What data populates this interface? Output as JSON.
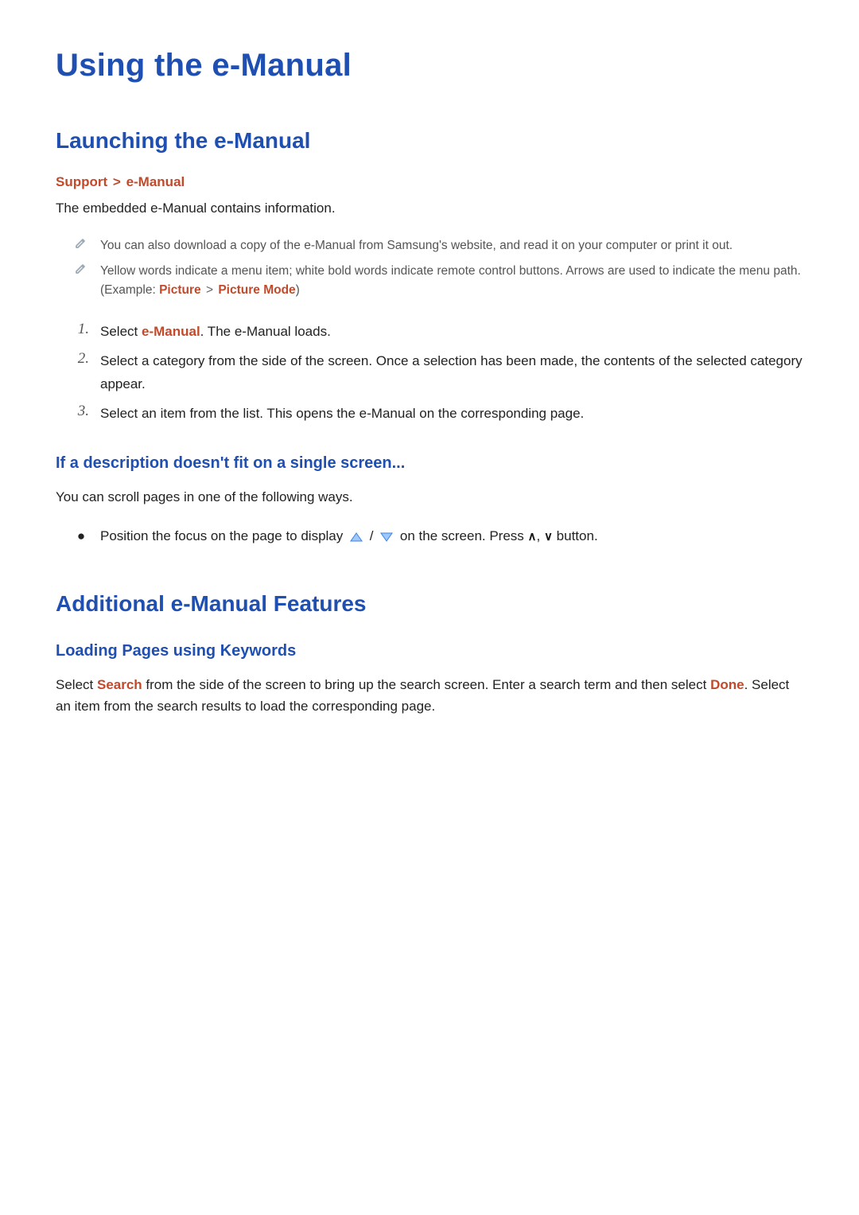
{
  "colors": {
    "primary_blue": "#1f4fb0",
    "accent_orange": "#c24a2a",
    "note_gray": "#9aa9b7"
  },
  "title": "Using the e-Manual",
  "section1": {
    "heading": "Launching the e-Manual",
    "breadcrumb": {
      "a": "Support",
      "sep": ">",
      "b": "e-Manual"
    },
    "intro": "The embedded e-Manual contains information.",
    "notes": [
      "You can also download a copy of the e-Manual from Samsung's website, and read it on your computer or print it out.",
      {
        "pre": "Yellow words indicate a menu item; white bold words indicate remote control buttons. Arrows are used to indicate the menu path. (Example: ",
        "path_a": "Picture",
        "sep": ">",
        "path_b": "Picture Mode",
        "post": ")"
      }
    ],
    "steps": [
      {
        "n": "1.",
        "pre": "Select ",
        "link": "e-Manual",
        "post": ". The e-Manual loads."
      },
      {
        "n": "2.",
        "text": "Select a category from the side of the screen. Once a selection has been made, the contents of the selected category appear."
      },
      {
        "n": "3.",
        "text": "Select an item from the list. This opens the e-Manual on the corresponding page."
      }
    ],
    "sub": {
      "heading": "If a description doesn't fit on a single screen...",
      "text": "You can scroll pages in one of the following ways.",
      "bullet": {
        "pre": "Position the focus on the page to display ",
        "mid": " / ",
        "after_icons": " on the screen. Press ",
        "caret_up": "∧",
        "comma": ", ",
        "caret_down": "∨",
        "post": " button."
      }
    }
  },
  "section2": {
    "heading": "Additional e-Manual Features",
    "sub_heading": "Loading Pages using Keywords",
    "para": {
      "pre": "Select ",
      "link1": "Search",
      "mid": " from the side of the screen to bring up the search screen. Enter a search term and then select ",
      "link2": "Done",
      "post": ". Select an item from the search results to load the corresponding page."
    }
  },
  "icons": {
    "pencil": "note-pencil-icon",
    "scroll_up": "scroll-up-icon",
    "scroll_down": "scroll-down-icon"
  }
}
